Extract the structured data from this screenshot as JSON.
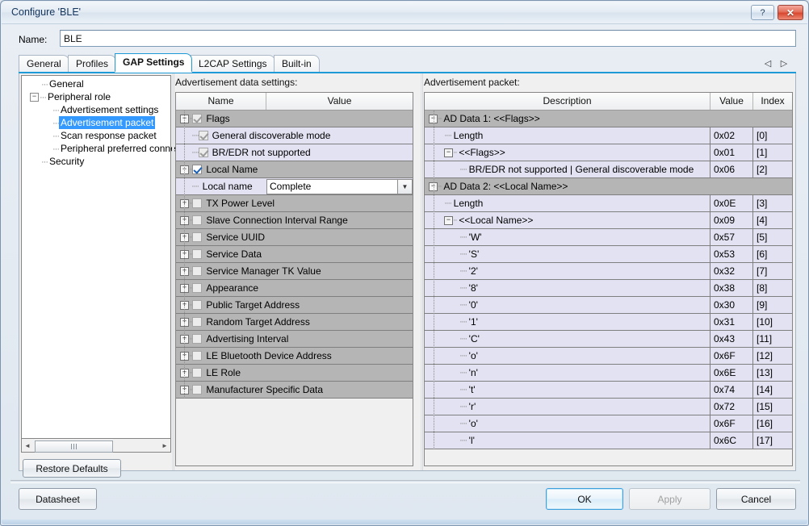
{
  "window": {
    "title": "Configure 'BLE'",
    "help_button": "?",
    "close_button": "✕"
  },
  "name_row": {
    "label": "Name:",
    "value": "BLE",
    "placeholder": ""
  },
  "tabs": {
    "items": [
      {
        "label": "General",
        "active": false
      },
      {
        "label": "Profiles",
        "active": false
      },
      {
        "label": "GAP Settings",
        "active": true
      },
      {
        "label": "L2CAP Settings",
        "active": false
      },
      {
        "label": "Built-in",
        "active": false
      }
    ],
    "scroll_left": "◁",
    "scroll_right": "▷"
  },
  "tree": {
    "items": [
      {
        "label": "General",
        "depth": 1,
        "expander": "",
        "selected": false
      },
      {
        "label": "Peripheral role",
        "depth": 0,
        "expander": "−",
        "selected": false
      },
      {
        "label": "Advertisement settings",
        "depth": 2,
        "expander": "",
        "selected": false
      },
      {
        "label": "Advertisement packet",
        "depth": 2,
        "expander": "",
        "selected": true
      },
      {
        "label": "Scan response packet",
        "depth": 2,
        "expander": "",
        "selected": false
      },
      {
        "label": "Peripheral preferred conne",
        "depth": 2,
        "expander": "",
        "selected": false
      },
      {
        "label": "Security",
        "depth": 1,
        "expander": "",
        "selected": false
      }
    ],
    "hscroll": {
      "left_arrow": "◄",
      "right_arrow": "►",
      "thumb_grip": "‖‖"
    },
    "restore_button": "Restore Defaults"
  },
  "adv_settings": {
    "caption": "Advertisement data settings:",
    "columns": [
      "Name",
      "Value"
    ],
    "rows": [
      {
        "label": "Flags",
        "kind": "group",
        "expander": "−",
        "checkbox": "checked-disabled",
        "indent": 0,
        "value": ""
      },
      {
        "label": "General discoverable mode",
        "kind": "child",
        "expander": "",
        "checkbox": "checked-disabled",
        "indent": 1,
        "value": ""
      },
      {
        "label": "BR/EDR not supported",
        "kind": "child",
        "expander": "",
        "checkbox": "checked-disabled",
        "indent": 1,
        "value": ""
      },
      {
        "label": "Local Name",
        "kind": "group",
        "expander": "−",
        "checkbox": "checked",
        "indent": 0,
        "value": ""
      },
      {
        "label": "Local name",
        "kind": "child",
        "expander": "",
        "checkbox": "none",
        "indent": 1,
        "value": "Complete",
        "editor": "combo"
      },
      {
        "label": "TX Power Level",
        "kind": "group",
        "expander": "+",
        "checkbox": "unchecked",
        "indent": 0,
        "value": ""
      },
      {
        "label": "Slave Connection Interval Range",
        "kind": "group",
        "expander": "+",
        "checkbox": "unchecked",
        "indent": 0,
        "value": ""
      },
      {
        "label": "Service UUID",
        "kind": "group",
        "expander": "+",
        "checkbox": "unchecked",
        "indent": 0,
        "value": ""
      },
      {
        "label": "Service Data",
        "kind": "group",
        "expander": "+",
        "checkbox": "unchecked",
        "indent": 0,
        "value": ""
      },
      {
        "label": "Service Manager TK Value",
        "kind": "group",
        "expander": "+",
        "checkbox": "unchecked",
        "indent": 0,
        "value": ""
      },
      {
        "label": "Appearance",
        "kind": "group",
        "expander": "+",
        "checkbox": "unchecked",
        "indent": 0,
        "value": ""
      },
      {
        "label": "Public Target Address",
        "kind": "group",
        "expander": "+",
        "checkbox": "unchecked",
        "indent": 0,
        "value": ""
      },
      {
        "label": "Random Target Address",
        "kind": "group",
        "expander": "+",
        "checkbox": "unchecked",
        "indent": 0,
        "value": ""
      },
      {
        "label": "Advertising Interval",
        "kind": "group",
        "expander": "+",
        "checkbox": "unchecked",
        "indent": 0,
        "value": ""
      },
      {
        "label": "LE Bluetooth Device Address",
        "kind": "group",
        "expander": "+",
        "checkbox": "unchecked",
        "indent": 0,
        "value": ""
      },
      {
        "label": "LE Role",
        "kind": "group",
        "expander": "+",
        "checkbox": "unchecked",
        "indent": 0,
        "value": ""
      },
      {
        "label": "Manufacturer Specific Data",
        "kind": "group",
        "expander": "+",
        "checkbox": "unchecked",
        "indent": 0,
        "value": ""
      }
    ],
    "combo_arrow": "▼"
  },
  "adv_packet": {
    "caption": "Advertisement packet:",
    "columns": [
      "Description",
      "Value",
      "Index"
    ],
    "rows": [
      {
        "desc": "AD Data 1: <<Flags>>",
        "value": "",
        "index": "",
        "kind": "group",
        "expander": "−",
        "indent": 0
      },
      {
        "desc": "Length",
        "value": "0x02",
        "index": "[0]",
        "kind": "child",
        "expander": "",
        "indent": 1
      },
      {
        "desc": "<<Flags>>",
        "value": "0x01",
        "index": "[1]",
        "kind": "child",
        "expander": "−",
        "indent": 1
      },
      {
        "desc": "BR/EDR not supported | General discoverable mode",
        "value": "0x06",
        "index": "[2]",
        "kind": "child",
        "expander": "",
        "indent": 2
      },
      {
        "desc": "AD Data 2: <<Local Name>>",
        "value": "",
        "index": "",
        "kind": "group",
        "expander": "−",
        "indent": 0
      },
      {
        "desc": "Length",
        "value": "0x0E",
        "index": "[3]",
        "kind": "child",
        "expander": "",
        "indent": 1
      },
      {
        "desc": "<<Local Name>>",
        "value": "0x09",
        "index": "[4]",
        "kind": "child",
        "expander": "−",
        "indent": 1
      },
      {
        "desc": "'W'",
        "value": "0x57",
        "index": "[5]",
        "kind": "child",
        "expander": "",
        "indent": 2
      },
      {
        "desc": "'S'",
        "value": "0x53",
        "index": "[6]",
        "kind": "child",
        "expander": "",
        "indent": 2
      },
      {
        "desc": "'2'",
        "value": "0x32",
        "index": "[7]",
        "kind": "child",
        "expander": "",
        "indent": 2
      },
      {
        "desc": "'8'",
        "value": "0x38",
        "index": "[8]",
        "kind": "child",
        "expander": "",
        "indent": 2
      },
      {
        "desc": "'0'",
        "value": "0x30",
        "index": "[9]",
        "kind": "child",
        "expander": "",
        "indent": 2
      },
      {
        "desc": "'1'",
        "value": "0x31",
        "index": "[10]",
        "kind": "child",
        "expander": "",
        "indent": 2
      },
      {
        "desc": "'C'",
        "value": "0x43",
        "index": "[11]",
        "kind": "child",
        "expander": "",
        "indent": 2
      },
      {
        "desc": "'o'",
        "value": "0x6F",
        "index": "[12]",
        "kind": "child",
        "expander": "",
        "indent": 2
      },
      {
        "desc": "'n'",
        "value": "0x6E",
        "index": "[13]",
        "kind": "child",
        "expander": "",
        "indent": 2
      },
      {
        "desc": "'t'",
        "value": "0x74",
        "index": "[14]",
        "kind": "child",
        "expander": "",
        "indent": 2
      },
      {
        "desc": "'r'",
        "value": "0x72",
        "index": "[15]",
        "kind": "child",
        "expander": "",
        "indent": 2
      },
      {
        "desc": "'o'",
        "value": "0x6F",
        "index": "[16]",
        "kind": "child",
        "expander": "",
        "indent": 2
      },
      {
        "desc": "'l'",
        "value": "0x6C",
        "index": "[17]",
        "kind": "child",
        "expander": "",
        "indent": 2
      }
    ]
  },
  "footer": {
    "datasheet": "Datasheet",
    "ok": "OK",
    "apply": "Apply",
    "cancel": "Cancel"
  },
  "colors": {
    "accent": "#1e9ad6",
    "selection": "#3399ff",
    "group_row": "#b5b5b5",
    "child_row": "#e2e2f2",
    "close_button": "#d8472f"
  }
}
